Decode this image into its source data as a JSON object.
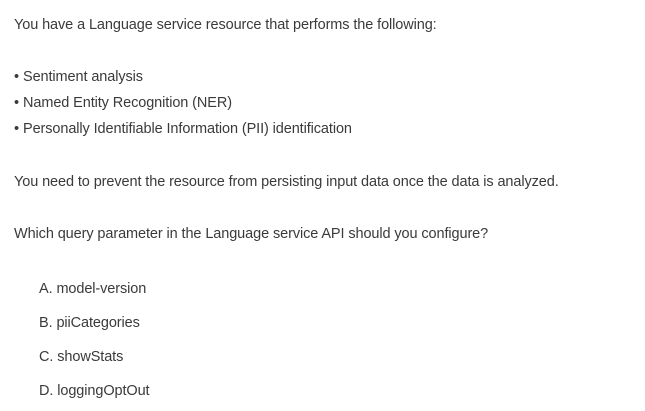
{
  "question": {
    "intro": "You have a Language service resource that performs the following:",
    "bullets": [
      "Sentiment analysis",
      "Named Entity Recognition (NER)",
      "Personally Identifiable Information (PII) identification"
    ],
    "requirement": "You need to prevent the resource from persisting input data once the data is analyzed.",
    "prompt": "Which query parameter in the Language service API should you configure?"
  },
  "bullet_glyph": "•",
  "options": [
    {
      "letter": "A.",
      "text": "model-version"
    },
    {
      "letter": "B.",
      "text": "piiCategories"
    },
    {
      "letter": "C.",
      "text": "showStats"
    },
    {
      "letter": "D.",
      "text": "loggingOptOut"
    }
  ]
}
